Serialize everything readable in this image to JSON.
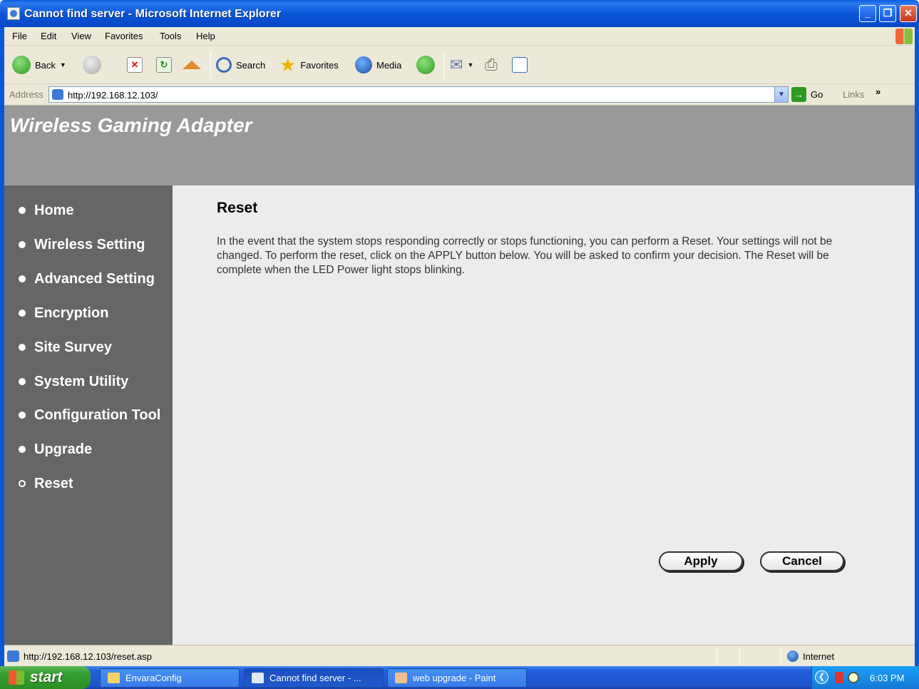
{
  "window": {
    "title": "Cannot find server - Microsoft Internet Explorer",
    "min_glyph": "_",
    "max_glyph": "❐",
    "close_glyph": "✕"
  },
  "menubar": {
    "items": [
      "File",
      "Edit",
      "View",
      "Favorites",
      "Tools",
      "Help"
    ]
  },
  "toolbar": {
    "back_label": "Back",
    "search_label": "Search",
    "favorites_label": "Favorites",
    "media_label": "Media"
  },
  "address": {
    "label": "Address",
    "url": "http://192.168.12.103/",
    "go_label": "Go",
    "links_label": "Links",
    "links_more": "»"
  },
  "banner": {
    "title": "Wireless Gaming Adapter"
  },
  "sidebar": {
    "items": [
      {
        "label": "Home"
      },
      {
        "label": "Wireless Setting"
      },
      {
        "label": "Advanced Setting"
      },
      {
        "label": "Encryption"
      },
      {
        "label": "Site Survey"
      },
      {
        "label": "System Utility"
      },
      {
        "label": "Configuration Tool"
      },
      {
        "label": "Upgrade"
      },
      {
        "label": "Reset"
      }
    ],
    "active": "Reset"
  },
  "content": {
    "title": "Reset",
    "description": "In the event that the system stops responding correctly or stops functioning, you can perform a Reset. Your settings will not be changed. To perform the reset, click on the APPLY button below. You will be asked to confirm your decision. The Reset will be complete when the LED Power light stops blinking.",
    "apply_label": "Apply",
    "cancel_label": "Cancel"
  },
  "statusbar": {
    "url": "http://192.168.12.103/reset.asp",
    "zone": "Internet"
  },
  "taskbar": {
    "start_label": "start",
    "tasks": [
      {
        "label": "EnvaraConfig"
      },
      {
        "label": "Cannot find server - ..."
      },
      {
        "label": "web upgrade - Paint"
      }
    ],
    "clock": "6:03 PM"
  },
  "colors": {
    "banner": "#999999",
    "sidebar": "#666666",
    "content_bg": "#ececec",
    "xp_blue": "#0a57d8"
  }
}
